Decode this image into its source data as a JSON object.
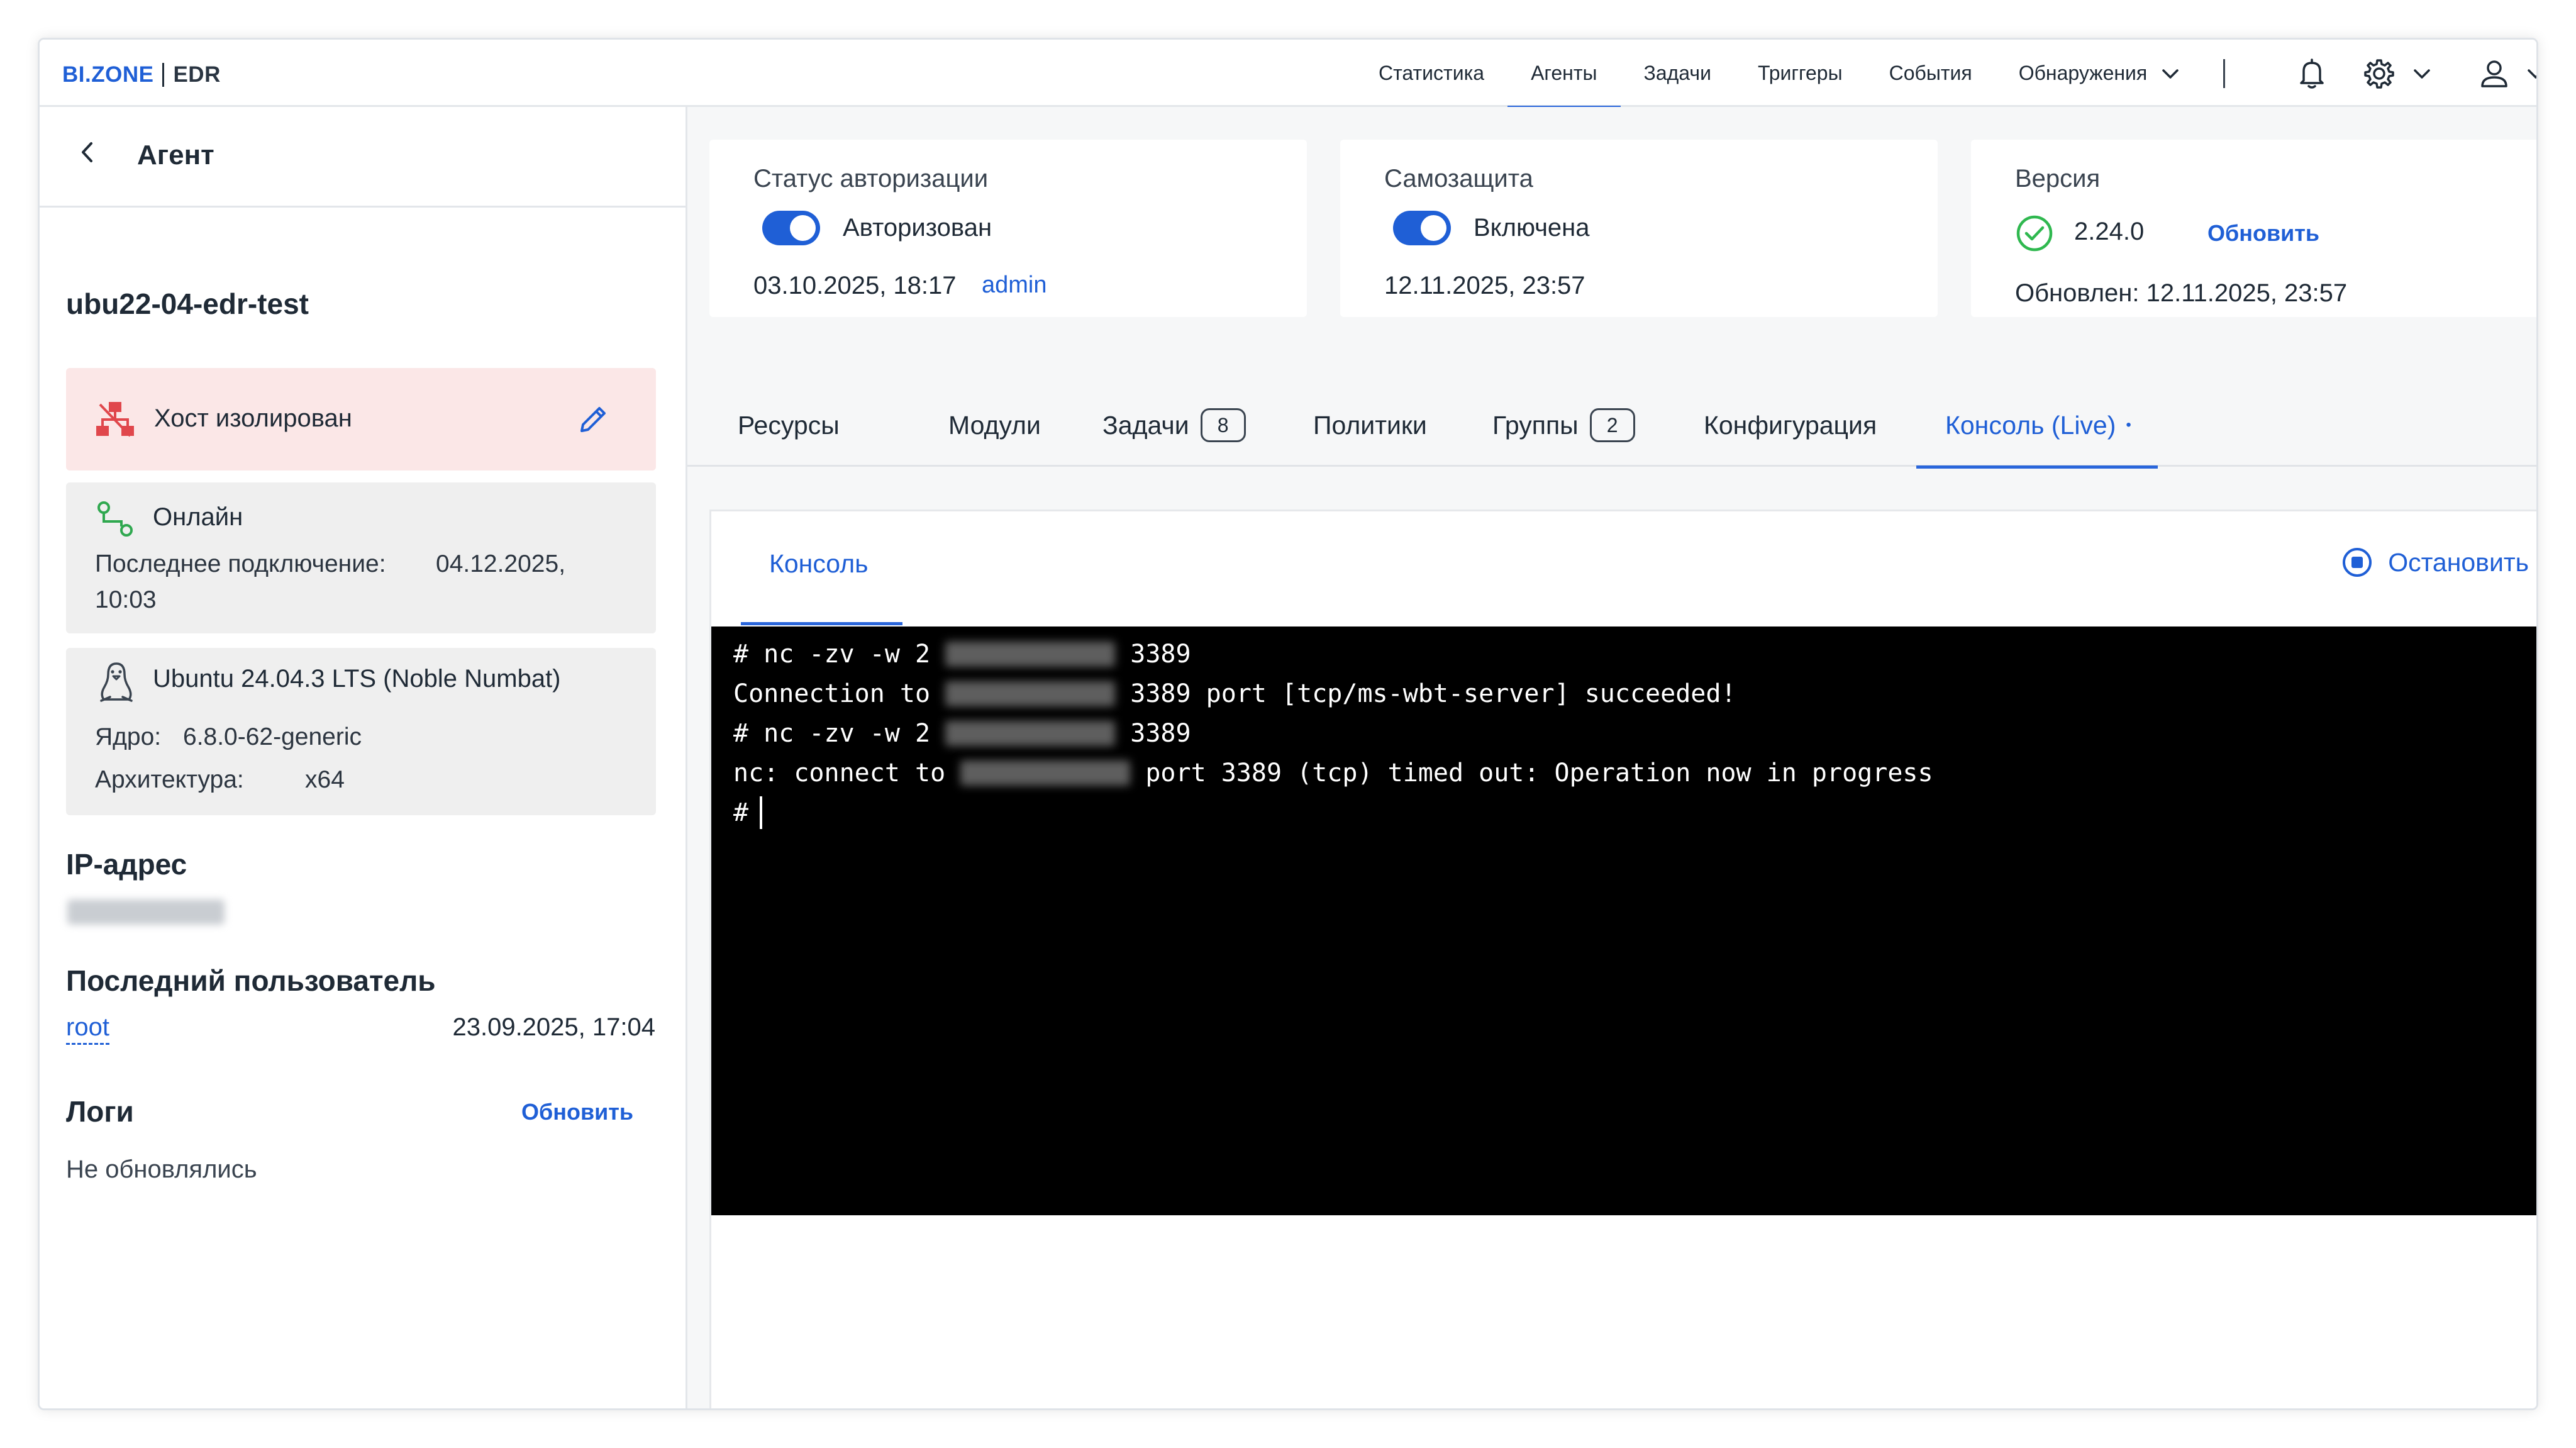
{
  "header": {
    "brand": "BI.ZONE",
    "product": "EDR",
    "nav": [
      "Статистика",
      "Агенты",
      "Задачи",
      "Триггеры",
      "События",
      "Обнаружения"
    ],
    "active_nav": "Агенты",
    "icons": [
      "bell-icon",
      "gear-icon",
      "chevron-down-icon",
      "user-icon",
      "chevron-down-icon"
    ]
  },
  "sidebar": {
    "title": "Агент",
    "hostname": "ubu22-04-edr-test",
    "isolation": {
      "label": "Хост изолирован"
    },
    "status": {
      "label": "Онлайн",
      "last_connection_label": "Последнее подключение:",
      "last_connection_date": "04.12.2025,",
      "last_connection_time": "10:03"
    },
    "os": {
      "name": "Ubuntu 24.04.3 LTS (Noble Numbat)",
      "kernel_label": "Ядро:",
      "kernel_value": "6.8.0-62-generic",
      "arch_label": "Архитектура:",
      "arch_value": "x64"
    },
    "ip_title": "IP-адрес",
    "last_user_title": "Последний пользователь",
    "last_user": "root",
    "last_user_time": "23.09.2025, 17:04",
    "logs_title": "Логи",
    "logs_update": "Обновить",
    "logs_status": "Не обновлялись"
  },
  "cards": {
    "auth": {
      "title": "Статус авторизации",
      "state": "Авторизован",
      "date": "03.10.2025, 18:17",
      "user": "admin"
    },
    "selfprotect": {
      "title": "Самозащита",
      "state": "Включена",
      "date": "12.11.2025, 23:57"
    },
    "version": {
      "title": "Версия",
      "value": "2.24.0",
      "update": "Обновить",
      "updated": "Обновлен: 12.11.2025, 23:57"
    }
  },
  "tabs": {
    "resources": "Ресурсы",
    "modules": "Модули",
    "tasks": "Задачи",
    "tasks_count": "8",
    "policies": "Политики",
    "groups": "Группы",
    "groups_count": "2",
    "config": "Конфигурация",
    "console": "Консоль (Live)",
    "console_dot": "•"
  },
  "console": {
    "tab": "Консоль",
    "stop": "Остановить",
    "lines": [
      {
        "pre": "# nc -zv -w 2 ",
        "post": " 3389"
      },
      {
        "pre": "Connection to ",
        "post": " 3389 port [tcp/ms-wbt-server] succeeded!"
      },
      {
        "pre": "# nc -zv -w 2 ",
        "post": " 3389"
      },
      {
        "pre": "nc: connect to ",
        "post": " port 3389 (tcp) timed out: Operation now in progress"
      }
    ],
    "prompt": "#"
  }
}
